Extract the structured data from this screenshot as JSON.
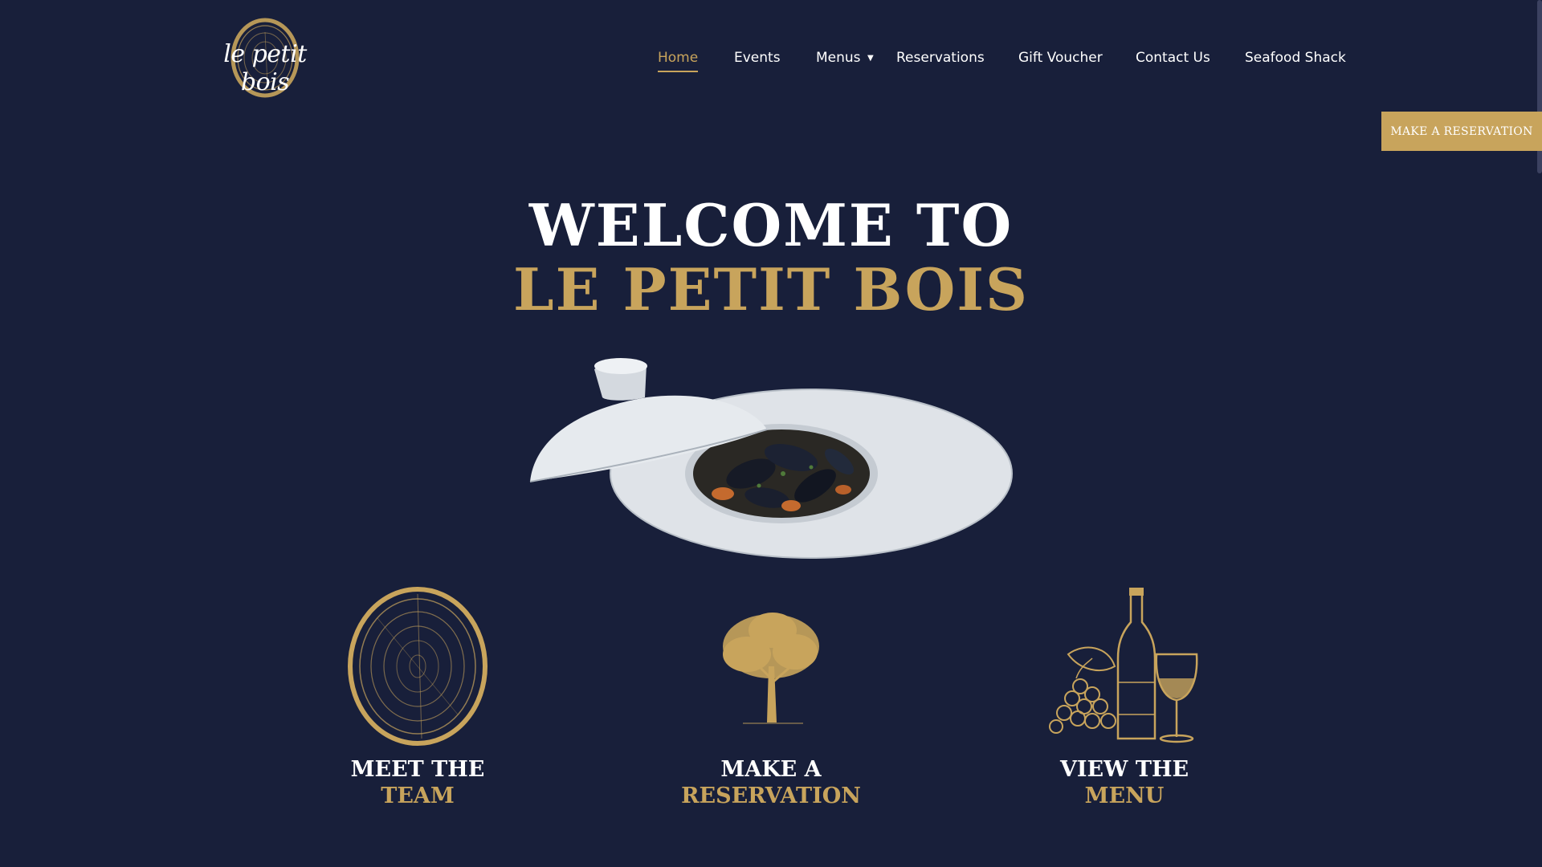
{
  "brand": {
    "logo_text": "le petit bois"
  },
  "nav": {
    "items": [
      {
        "label": "Home",
        "active": true
      },
      {
        "label": "Events"
      },
      {
        "label": "Menus",
        "has_dropdown": true
      },
      {
        "label": "Reservations"
      },
      {
        "label": "Gift Voucher"
      },
      {
        "label": "Contact Us"
      },
      {
        "label": "Seafood Shack"
      }
    ],
    "dropdown_icon": "chevron-down-icon"
  },
  "cta": {
    "label": "MAKE A RESERVATION"
  },
  "hero": {
    "line1": "WELCOME TO",
    "line2": "LE PETIT BOIS"
  },
  "features": [
    {
      "line1": "MEET THE",
      "line2": "TEAM",
      "icon": "wood-slice-icon"
    },
    {
      "line1": "MAKE A",
      "line2": "RESERVATION",
      "icon": "tree-icon"
    },
    {
      "line1": "VIEW THE",
      "line2": "MENU",
      "icon": "wine-bottle-glass-icon"
    }
  ],
  "colors": {
    "background": "#181f3a",
    "accent": "#c8a45c",
    "text": "#ffffff"
  }
}
